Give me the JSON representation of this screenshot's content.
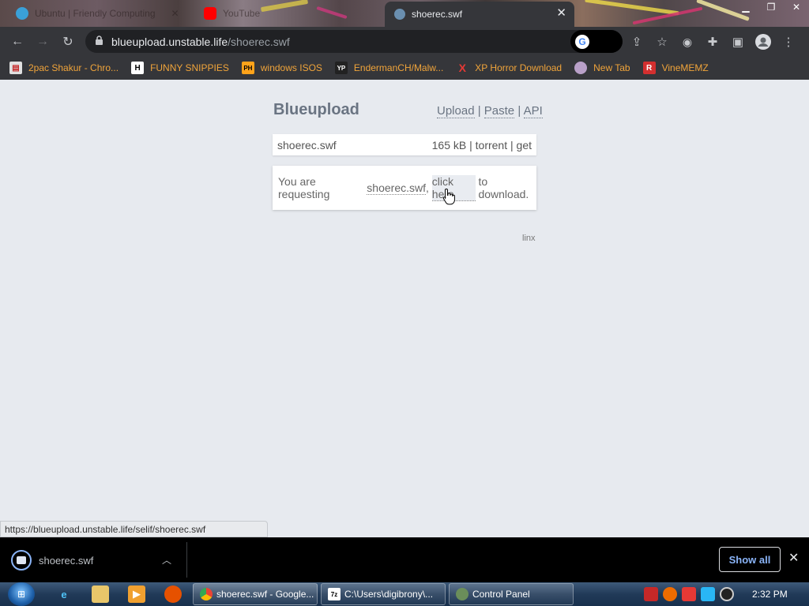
{
  "browser": {
    "tabs": [
      {
        "label": "Ubuntu | Friendly Computing",
        "active": false
      },
      {
        "label": "YouTube",
        "active": false
      },
      {
        "label": "shoerec.swf",
        "active": true
      }
    ],
    "close_symbol": "✕",
    "address": {
      "host": "blueupload.unstable.life",
      "path": "/shoerec.swf"
    },
    "bookmarks": [
      {
        "label": "2pac Shakur - Chro...",
        "icon": "bag-icon",
        "color": "#e0e0e0"
      },
      {
        "label": "FUNNY SNIPPIES",
        "icon": "h-icon",
        "glyph": "H",
        "color": "#ffffff"
      },
      {
        "label": "windows ISOS",
        "icon": "ph-icon",
        "glyph": "PH",
        "color": "#ffa31a"
      },
      {
        "label": "EndermanCH/Malw...",
        "icon": "yp-icon",
        "glyph": "YP",
        "color": "#444444"
      },
      {
        "label": "XP Horror Download",
        "icon": "x-icon",
        "glyph": "X",
        "color": "#e53935"
      },
      {
        "label": "New Tab",
        "icon": "avatar-icon",
        "color": "#b9a0c8"
      },
      {
        "label": "VineMEMZ",
        "icon": "r-icon",
        "glyph": "R",
        "color": "#d32f2f"
      }
    ]
  },
  "page": {
    "brand": "Blueupload",
    "nav": {
      "upload": "Upload",
      "sep": "|",
      "paste": "Paste",
      "api": "API"
    },
    "file": {
      "name": "shoerec.swf",
      "size": "165 kB",
      "torrent": "torrent",
      "get": "get",
      "sep": "|"
    },
    "request": {
      "prefix": "You are requesting",
      "filename": "shoerec.swf",
      "comma": ",",
      "link": "click here",
      "suffix": "to download."
    },
    "footer": "linx"
  },
  "status_url": "https://blueupload.unstable.life/selif/shoerec.swf",
  "download_shelf": {
    "filename": "shoerec.swf",
    "show_all": "Show all"
  },
  "taskbar": {
    "windows": [
      {
        "label": "shoerec.swf - Google...",
        "icon_color": "#4caf50",
        "active": true
      },
      {
        "label": "C:\\Users\\digibrony\\...",
        "icon_color": "#444444",
        "active": false
      },
      {
        "label": "Control Panel",
        "icon_color": "#6b8e5a",
        "active": false
      }
    ],
    "clock": "2:32 PM"
  }
}
